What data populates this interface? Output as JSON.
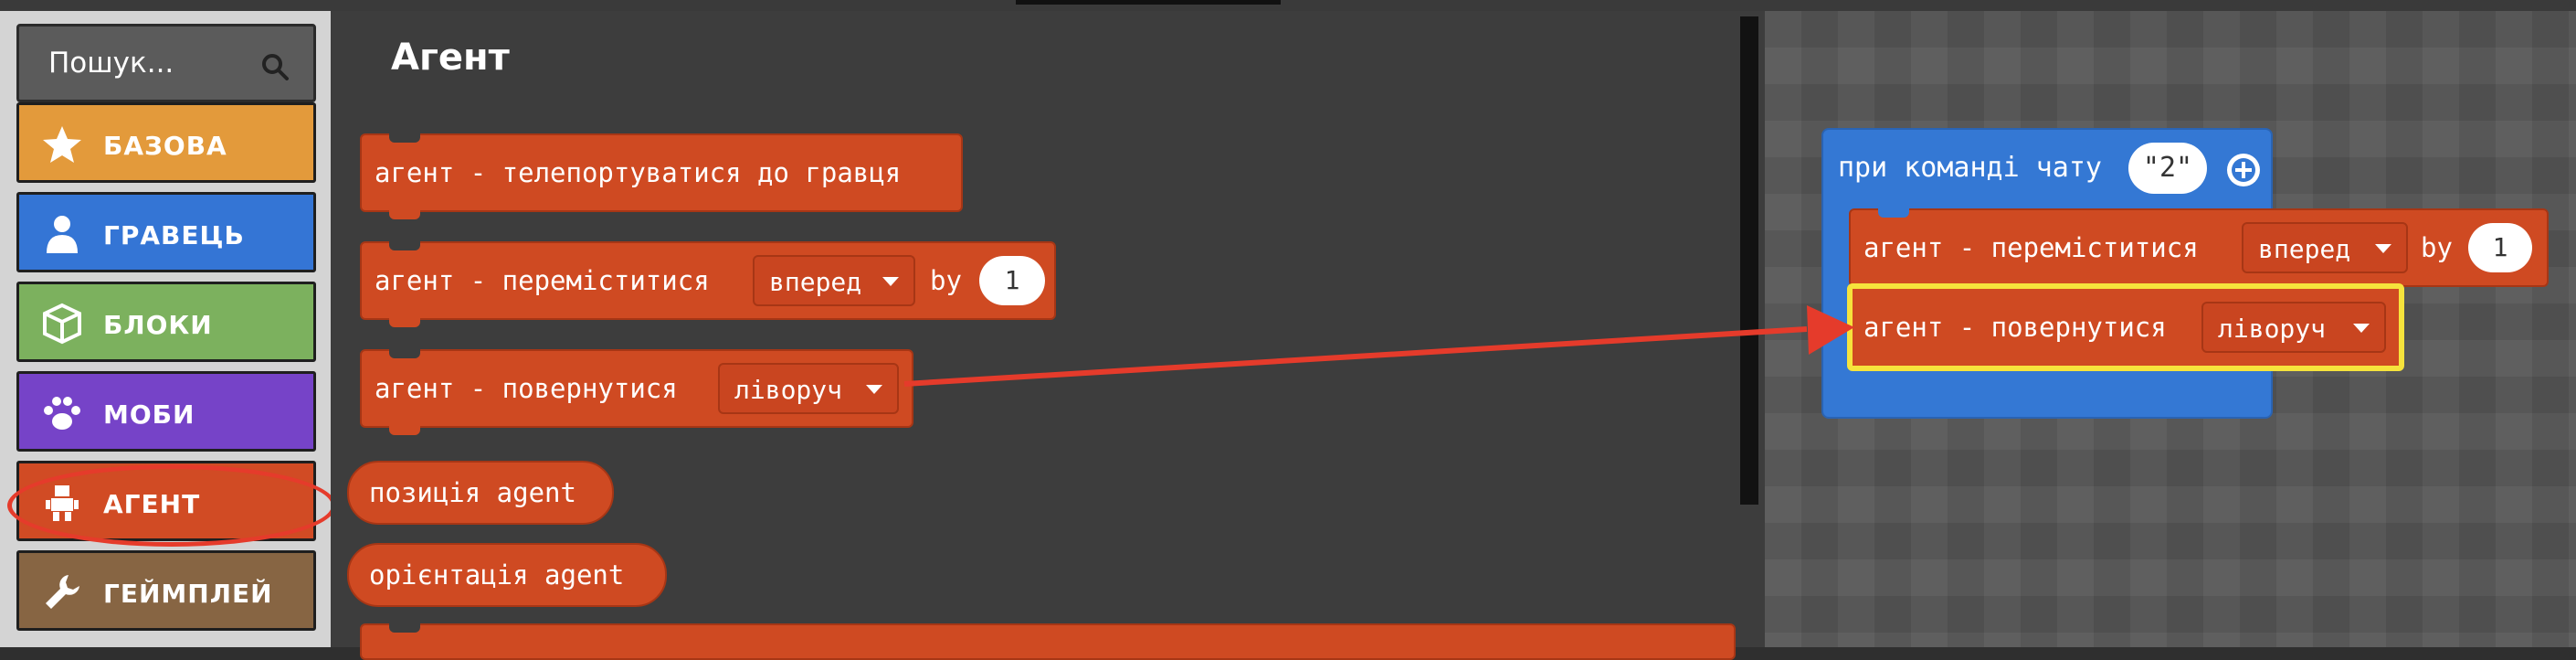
{
  "search": {
    "placeholder": "Пошук..."
  },
  "categories": [
    {
      "label": "БАЗОВА",
      "icon": "star-icon",
      "color": "#e39a3b"
    },
    {
      "label": "ГРАВЕЦЬ",
      "icon": "person-icon",
      "color": "#3475d5"
    },
    {
      "label": "БЛОКИ",
      "icon": "cube-icon",
      "color": "#7cb15e"
    },
    {
      "label": "МОБИ",
      "icon": "paw-icon",
      "color": "#7643c8"
    },
    {
      "label": "АГЕНТ",
      "icon": "robot-icon",
      "color": "#d14b24"
    },
    {
      "label": "ГЕЙМПЛЕЙ",
      "icon": "wrench-icon",
      "color": "#876543"
    }
  ],
  "flyout": {
    "title": "Агент",
    "blocks": {
      "teleport": "агент - телепортуватися до гравця",
      "move": {
        "text": "агент - переміститися",
        "dir": "вперед",
        "by": "by",
        "steps": "1"
      },
      "turn": {
        "text": "агент - повернутися",
        "dir": "ліворуч"
      },
      "position": "позиція agent",
      "orientation": "орієнтація agent"
    }
  },
  "workspace": {
    "event": {
      "text": "при команді чату",
      "command": "\"2\""
    },
    "move": {
      "text": "агент - переміститися",
      "dir": "вперед",
      "by": "by",
      "steps": "1"
    },
    "turn": {
      "text": "агент - повернутися",
      "dir": "ліворуч"
    }
  },
  "colors": {
    "agent": "#cf4a22",
    "event": "#3478d4",
    "highlight": "#f6e33c",
    "annotation": "#e53b2b"
  }
}
